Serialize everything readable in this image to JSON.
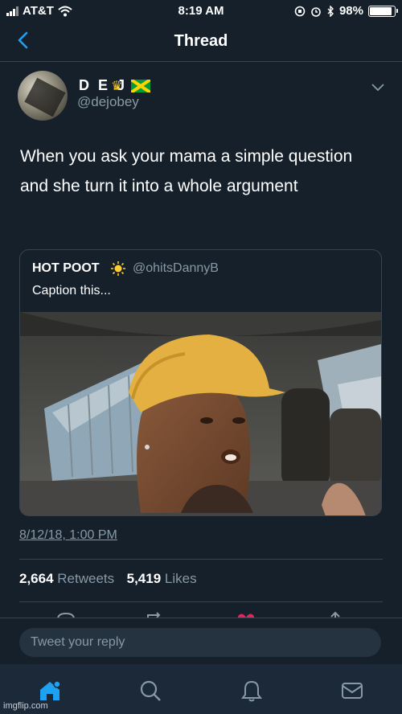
{
  "status_bar": {
    "carrier": "AT&T",
    "time": "8:19 AM",
    "battery": "98%",
    "battery_level": 0.98
  },
  "nav": {
    "title": "Thread"
  },
  "tweet": {
    "display_name": "D E J",
    "username": "@dejobey",
    "text": "When you ask your mama a simple question and she turn it into a whole argument",
    "date": "8/12/18, 1:00 PM",
    "retweets": "2,664",
    "retweets_label": "Retweets",
    "likes": "5,419",
    "likes_label": "Likes"
  },
  "quoted": {
    "name": "HOT POOT",
    "handle": "@ohitsDannyB",
    "text": "Caption this..."
  },
  "reply": {
    "placeholder": "Tweet your reply"
  },
  "watermark": "imgflip.com",
  "colors": {
    "background": "#15202b",
    "accent": "#1da1f2",
    "secondary_text": "#8899a6",
    "border": "#38444d"
  },
  "icons": {
    "back": "chevron-left-icon",
    "menu": "chevron-down-icon",
    "home": "home-icon",
    "search": "search-icon",
    "notifications": "bell-icon",
    "messages": "envelope-icon"
  }
}
